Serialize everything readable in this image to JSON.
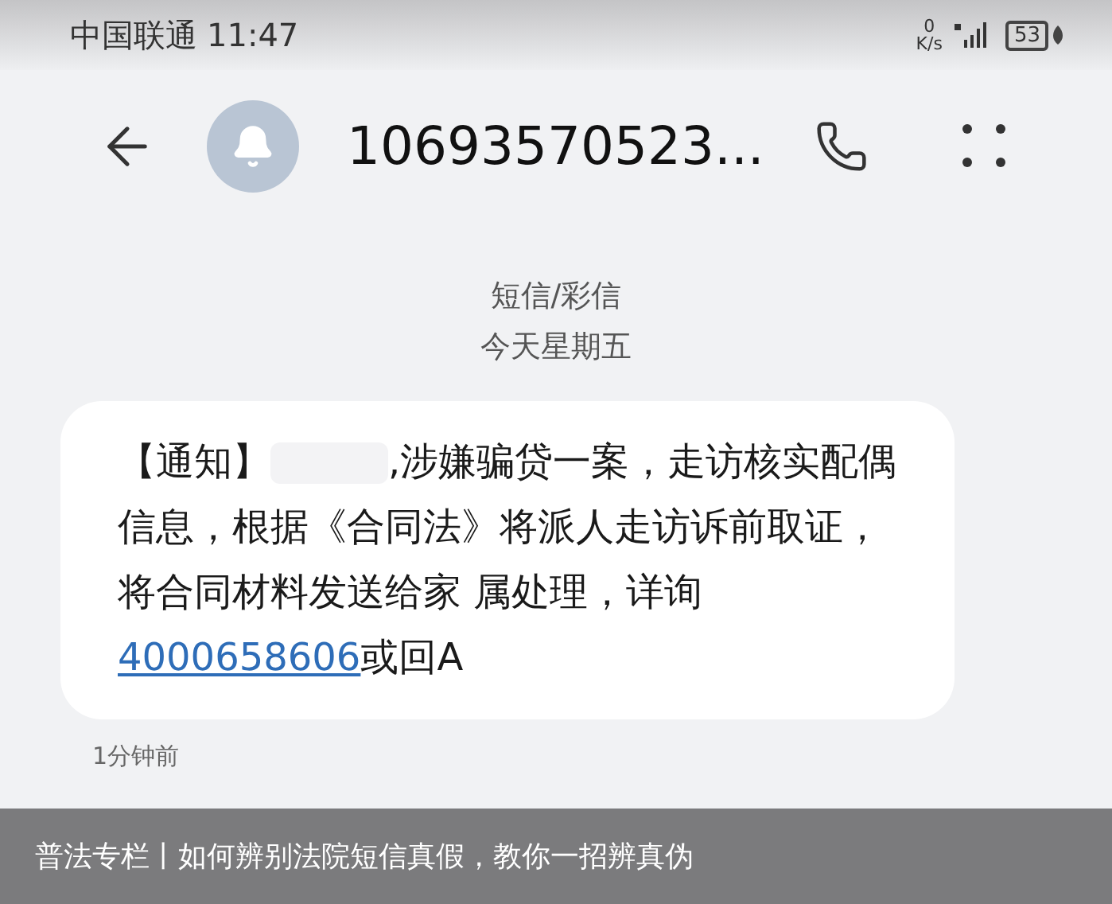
{
  "status_bar": {
    "carrier": "中国联通",
    "time": "11:47",
    "speed_value": "0",
    "speed_unit": "K/s",
    "battery": "53"
  },
  "header": {
    "title": "10693570523..."
  },
  "thread": {
    "channel": "短信/彩信",
    "date": "今天星期五"
  },
  "message": {
    "prefix": "【通知】",
    "body": ",涉嫌骗贷一案，走访核实配偶信息，根据《合同法》将派人走访诉前取证，将合同材料发送给家 属处理，详询",
    "link": "4000658606",
    "suffix": "或回A",
    "time": "1分钟前"
  },
  "caption": {
    "text": "普法专栏丨如何辨别法院短信真假，教你一招辨真伪"
  }
}
